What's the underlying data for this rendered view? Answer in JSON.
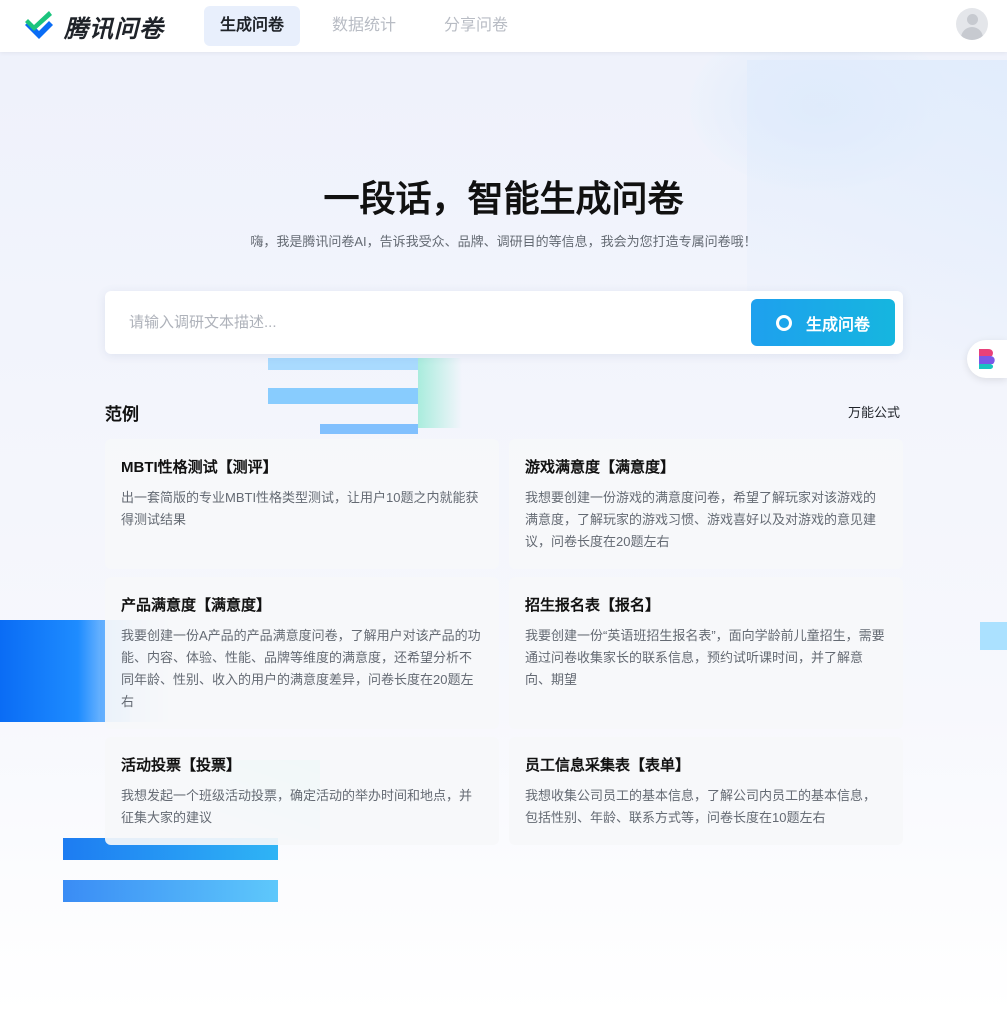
{
  "app": {
    "name": "腾讯问卷"
  },
  "nav": {
    "tabs": [
      {
        "label": "生成问卷",
        "active": true
      },
      {
        "label": "数据统计",
        "active": false
      },
      {
        "label": "分享问卷",
        "active": false
      }
    ]
  },
  "hero": {
    "title": "一段话，智能生成问卷",
    "subtitle": "嗨，我是腾讯问卷AI，告诉我受众、品牌、调研目的等信息，我会为您打造专属问卷哦！"
  },
  "search": {
    "placeholder": "请输入调研文本描述...",
    "value": "",
    "button_label": "生成问卷"
  },
  "examples": {
    "title": "范例",
    "link_label": "万能公式",
    "cards": [
      {
        "title": "MBTI性格测试【测评】",
        "desc": "出一套简版的专业MBTI性格类型测试，让用户10题之内就能获得测试结果"
      },
      {
        "title": "游戏满意度【满意度】",
        "desc": "我想要创建一份游戏的满意度问卷，希望了解玩家对该游戏的满意度，了解玩家的游戏习惯、游戏喜好以及对游戏的意见建议，问卷长度在20题左右"
      },
      {
        "title": "产品满意度【满意度】",
        "desc": "我要创建一份A产品的产品满意度问卷，了解用户对该产品的功能、内容、体验、性能、品牌等维度的满意度，还希望分析不同年龄、性别、收入的用户的满意度差异，问卷长度在20题左右"
      },
      {
        "title": "招生报名表【报名】",
        "desc": "我要创建一份“英语班招生报名表”，面向学龄前儿童招生，需要通过问卷收集家长的联系信息，预约试听课时间，并了解意向、期望"
      },
      {
        "title": "活动投票【投票】",
        "desc": "我想发起一个班级活动投票，确定活动的举办时间和地点，并征集大家的建议"
      },
      {
        "title": "员工信息采集表【表单】",
        "desc": "我想收集公司员工的基本信息，了解公司内员工的基本信息，包括性别、年龄、联系方式等，问卷长度在10题左右"
      }
    ]
  },
  "colors": {
    "accent": "#1ea0ee",
    "logo_check": "#1bc47d",
    "logo_v": "#0a6cf5"
  }
}
